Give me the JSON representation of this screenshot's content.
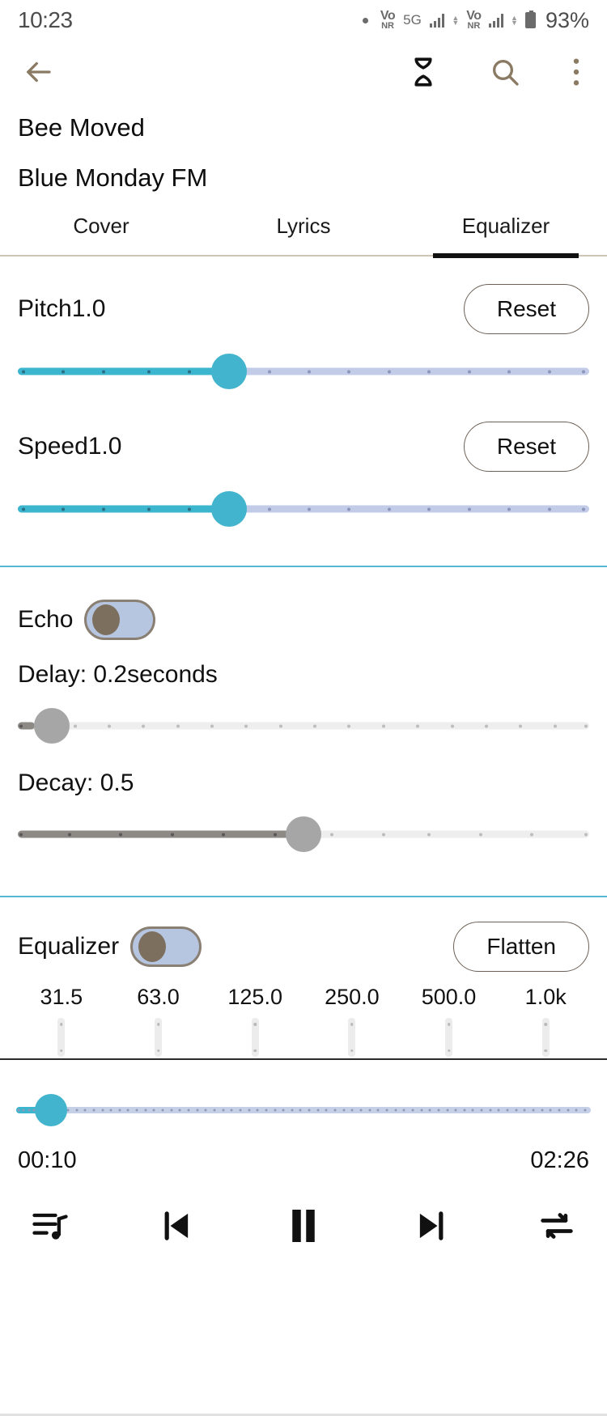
{
  "statusbar": {
    "time": "10:23",
    "network_label_1_top": "Vo",
    "network_label_1_bottom": "NR",
    "network_gen": "5G",
    "network_label_2_top": "Vo",
    "network_label_2_bottom": "NR",
    "battery_percent": "93%"
  },
  "toolbar": {
    "back_icon": "arrow-left-icon",
    "timer_icon": "hourglass-icon",
    "search_icon": "search-icon",
    "overflow_icon": "more-vertical-icon",
    "accent_color": "#8a7a63"
  },
  "now_playing": {
    "title": "Bee Moved",
    "artist": "Blue Monday FM"
  },
  "tabs": [
    {
      "label": "Cover",
      "active": false
    },
    {
      "label": "Lyrics",
      "active": false
    },
    {
      "label": "Equalizer",
      "active": true
    }
  ],
  "pitch": {
    "label": "Pitch1.0",
    "value": "1.0",
    "reset_label": "Reset",
    "percent": 37
  },
  "speed": {
    "label": "Speed1.0",
    "value": "1.0",
    "reset_label": "Reset",
    "percent": 37
  },
  "echo": {
    "label": "Echo",
    "enabled": true,
    "delay_label": "Delay: 0.2seconds",
    "delay_value": "0.2",
    "delay_percent": 3,
    "decay_label": "Decay: 0.5",
    "decay_value": "0.5",
    "decay_percent": 50
  },
  "equalizer": {
    "label": "Equalizer",
    "enabled": true,
    "flatten_label": "Flatten",
    "bands": [
      {
        "freq": "31.5",
        "level": 0
      },
      {
        "freq": "63.0",
        "level": 0
      },
      {
        "freq": "125.0",
        "level": 0
      },
      {
        "freq": "250.0",
        "level": 0
      },
      {
        "freq": "500.0",
        "level": 0
      },
      {
        "freq": "1.0k",
        "level": 0
      }
    ]
  },
  "player": {
    "elapsed": "00:10",
    "duration": "02:26",
    "progress_percent": 4,
    "playlist_icon": "playlist-music-icon",
    "previous_icon": "skip-previous-icon",
    "playpause_icon": "pause-icon",
    "next_icon": "skip-next-icon",
    "repeat_icon": "repeat-icon",
    "accent_color": "#43b4ce"
  }
}
